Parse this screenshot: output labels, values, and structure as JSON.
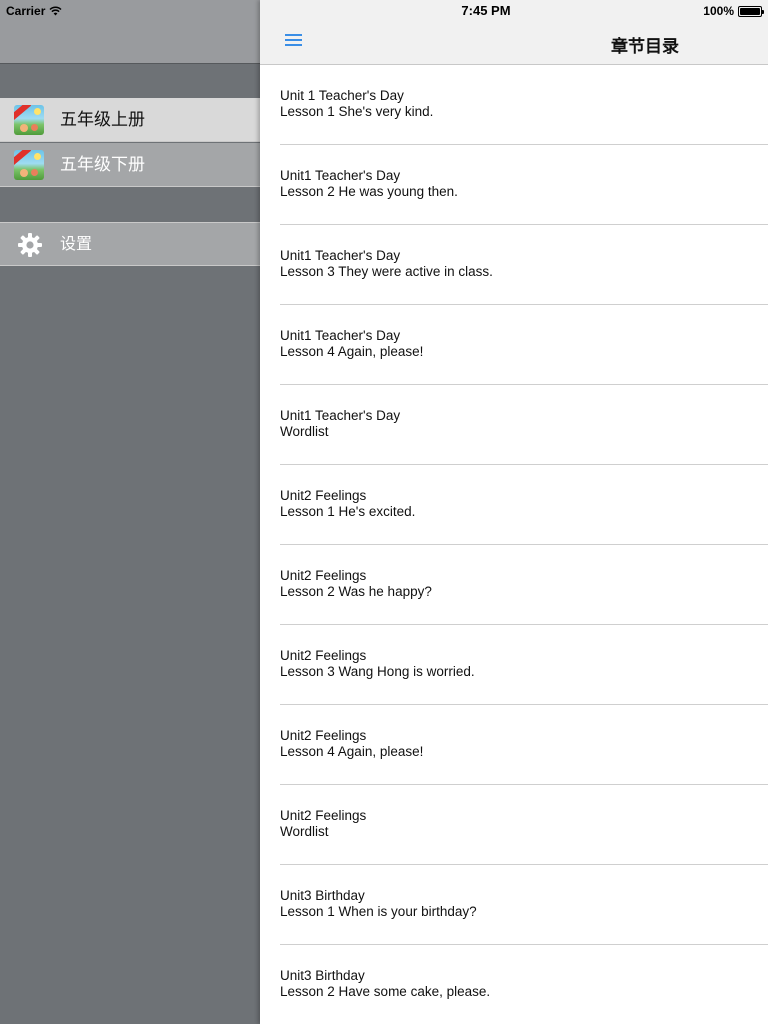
{
  "status_bar": {
    "carrier": "Carrier",
    "time": "7:45 PM",
    "battery": "100%"
  },
  "sidebar": {
    "items": [
      {
        "label": "五年级上册",
        "icon": "book-cover-icon",
        "selected": true
      },
      {
        "label": "五年级下册",
        "icon": "book-cover-icon",
        "selected": false
      }
    ],
    "settings": {
      "label": "设置",
      "icon": "gear-icon"
    }
  },
  "navbar": {
    "title": "章节目录",
    "menu_icon": "menu-icon"
  },
  "lessons": [
    {
      "unit": "Unit 1 Teacher's Day",
      "lesson": "Lesson 1 She's very kind."
    },
    {
      "unit": "Unit1 Teacher's Day",
      "lesson": "Lesson 2 He was young then."
    },
    {
      "unit": "Unit1 Teacher's Day",
      "lesson": "Lesson 3 They were active in class."
    },
    {
      "unit": "Unit1 Teacher's Day",
      "lesson": "Lesson 4 Again, please!"
    },
    {
      "unit": "Unit1 Teacher's Day",
      "lesson": "Wordlist"
    },
    {
      "unit": "Unit2 Feelings",
      "lesson": "Lesson 1 He's excited."
    },
    {
      "unit": "Unit2 Feelings",
      "lesson": "Lesson 2 Was he happy?"
    },
    {
      "unit": "Unit2 Feelings",
      "lesson": "Lesson 3 Wang Hong is worried."
    },
    {
      "unit": "Unit2 Feelings",
      "lesson": "Lesson 4 Again, please!"
    },
    {
      "unit": "Unit2 Feelings",
      "lesson": "Wordlist"
    },
    {
      "unit": "Unit3 Birthday",
      "lesson": "Lesson 1 When is your birthday?"
    },
    {
      "unit": "Unit3 Birthday",
      "lesson": "Lesson 2 Have some cake, please."
    }
  ],
  "colors": {
    "accent": "#3a8ee6",
    "sidebar_bg": "#6e7276",
    "selected_item_bg": "#d9d9d9",
    "navbar_bg": "#f1f1f1"
  }
}
